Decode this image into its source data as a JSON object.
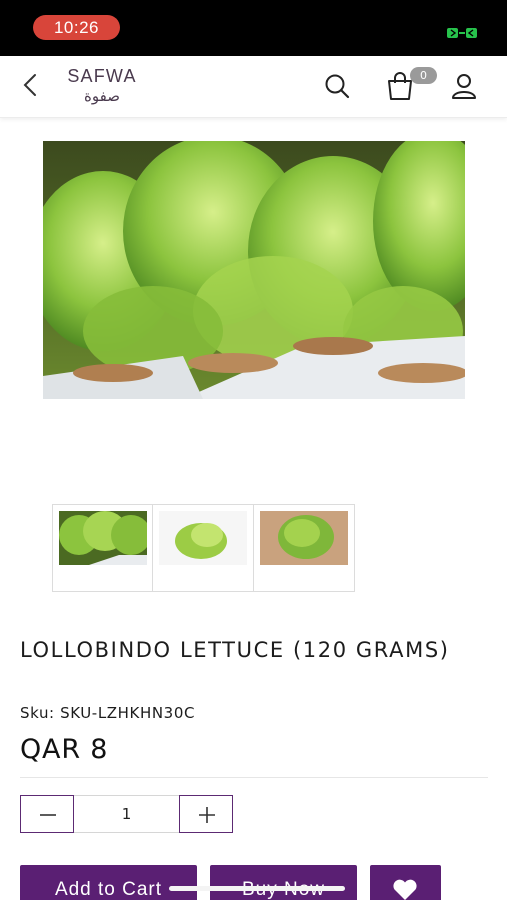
{
  "status_bar": {
    "time": "10:26"
  },
  "header": {
    "logo_en": "SAFWA",
    "logo_ar": "صفوة",
    "cart_count": "0"
  },
  "product": {
    "title": "LOLLOBINDO LETTUCE (120 GRAMS)",
    "sku": "Sku: SKU-LZHKHN30C",
    "price": "QAR 8",
    "quantity": "1",
    "thumbnail_count": 3
  },
  "actions": {
    "add_to_cart": "Add to Cart",
    "buy_now": "Buy Now"
  },
  "icons": {
    "back": "chevron-left-icon",
    "search": "search-icon",
    "cart": "shopping-bag-icon",
    "account": "user-icon",
    "wishlist": "heart-icon",
    "minus": "minus-icon",
    "plus": "plus-icon"
  },
  "colors": {
    "brand_purple": "#5a1f73",
    "status_pill": "#d8453a",
    "battery": "#27c24c"
  }
}
